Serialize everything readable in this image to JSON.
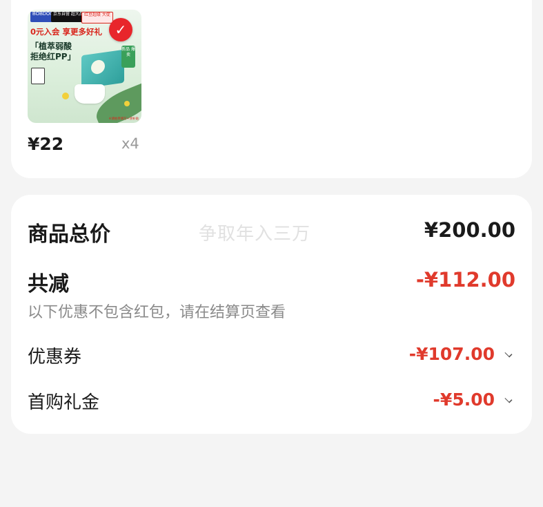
{
  "product": {
    "thumbnail": {
      "brand": "BOBDOG 巴布豆",
      "chip_black": "京东自营 超大品牌",
      "chip_red": "红豆超级 大促",
      "headline": "0元入会 享更多好礼",
      "slogan": "「植萃弱酸\n拒绝红PP」",
      "badge_icon": "check-icon",
      "tag_new": "新品 爆卖",
      "footnote": "※请拍单填写+领补贴"
    },
    "price": "¥22",
    "quantity": "x4"
  },
  "summary": {
    "watermark": "争取年入三万",
    "total_label": "商品总价",
    "total_value": "¥200.00",
    "discount_label": "共减",
    "discount_value": "-¥112.00",
    "discount_note": "以下优惠不包含红包，请在结算页查看",
    "coupon_label": "优惠券",
    "coupon_value": "-¥107.00",
    "gift_label": "首购礼金",
    "gift_value": "-¥5.00"
  },
  "colors": {
    "background": "#f4f4f4",
    "card": "#ffffff",
    "discount_red": "#e03a2c",
    "text": "#1a1a1a",
    "muted": "#8a8a8a"
  }
}
